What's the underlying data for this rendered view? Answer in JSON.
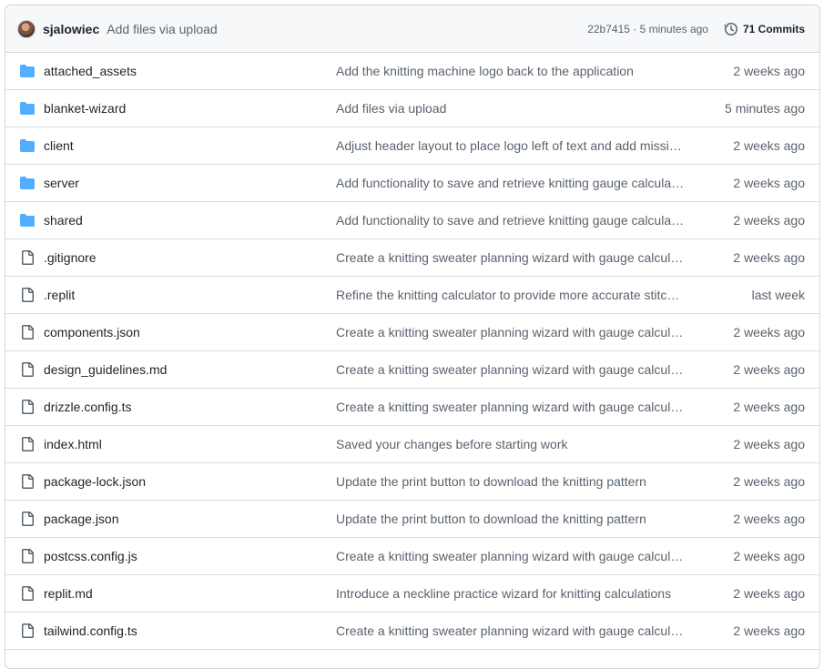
{
  "header": {
    "author": "sjalowiec",
    "message": "Add files via upload",
    "sha_time": "22b7415 · 5 minutes ago",
    "commits_label": "71 Commits"
  },
  "icons": {
    "folder": "folder-icon",
    "file": "file-icon",
    "history": "clock-icon"
  },
  "colors": {
    "folder": "#54aeff",
    "file_icon": "#59636e",
    "muted_text": "#59636e",
    "border": "#d0d7de"
  },
  "files": [
    {
      "type": "folder",
      "name": "attached_assets",
      "message": "Add the knitting machine logo back to the application",
      "age": "2 weeks ago"
    },
    {
      "type": "folder",
      "name": "blanket-wizard",
      "message": "Add files via upload",
      "age": "5 minutes ago"
    },
    {
      "type": "folder",
      "name": "client",
      "message": "Adjust header layout to place logo left of text and add missi…",
      "age": "2 weeks ago"
    },
    {
      "type": "folder",
      "name": "server",
      "message": "Add functionality to save and retrieve knitting gauge calcula…",
      "age": "2 weeks ago"
    },
    {
      "type": "folder",
      "name": "shared",
      "message": "Add functionality to save and retrieve knitting gauge calcula…",
      "age": "2 weeks ago"
    },
    {
      "type": "file",
      "name": ".gitignore",
      "message": "Create a knitting sweater planning wizard with gauge calcula…",
      "age": "2 weeks ago"
    },
    {
      "type": "file",
      "name": ".replit",
      "message": "Refine the knitting calculator to provide more accurate stitch…",
      "age": "last week"
    },
    {
      "type": "file",
      "name": "components.json",
      "message": "Create a knitting sweater planning wizard with gauge calcula…",
      "age": "2 weeks ago"
    },
    {
      "type": "file",
      "name": "design_guidelines.md",
      "message": "Create a knitting sweater planning wizard with gauge calcula…",
      "age": "2 weeks ago"
    },
    {
      "type": "file",
      "name": "drizzle.config.ts",
      "message": "Create a knitting sweater planning wizard with gauge calcula…",
      "age": "2 weeks ago"
    },
    {
      "type": "file",
      "name": "index.html",
      "message": "Saved your changes before starting work",
      "age": "2 weeks ago"
    },
    {
      "type": "file",
      "name": "package-lock.json",
      "message": "Update the print button to download the knitting pattern",
      "age": "2 weeks ago"
    },
    {
      "type": "file",
      "name": "package.json",
      "message": "Update the print button to download the knitting pattern",
      "age": "2 weeks ago"
    },
    {
      "type": "file",
      "name": "postcss.config.js",
      "message": "Create a knitting sweater planning wizard with gauge calcula…",
      "age": "2 weeks ago"
    },
    {
      "type": "file",
      "name": "replit.md",
      "message": "Introduce a neckline practice wizard for knitting calculations",
      "age": "2 weeks ago"
    },
    {
      "type": "file",
      "name": "tailwind.config.ts",
      "message": "Create a knitting sweater planning wizard with gauge calcula…",
      "age": "2 weeks ago"
    }
  ]
}
